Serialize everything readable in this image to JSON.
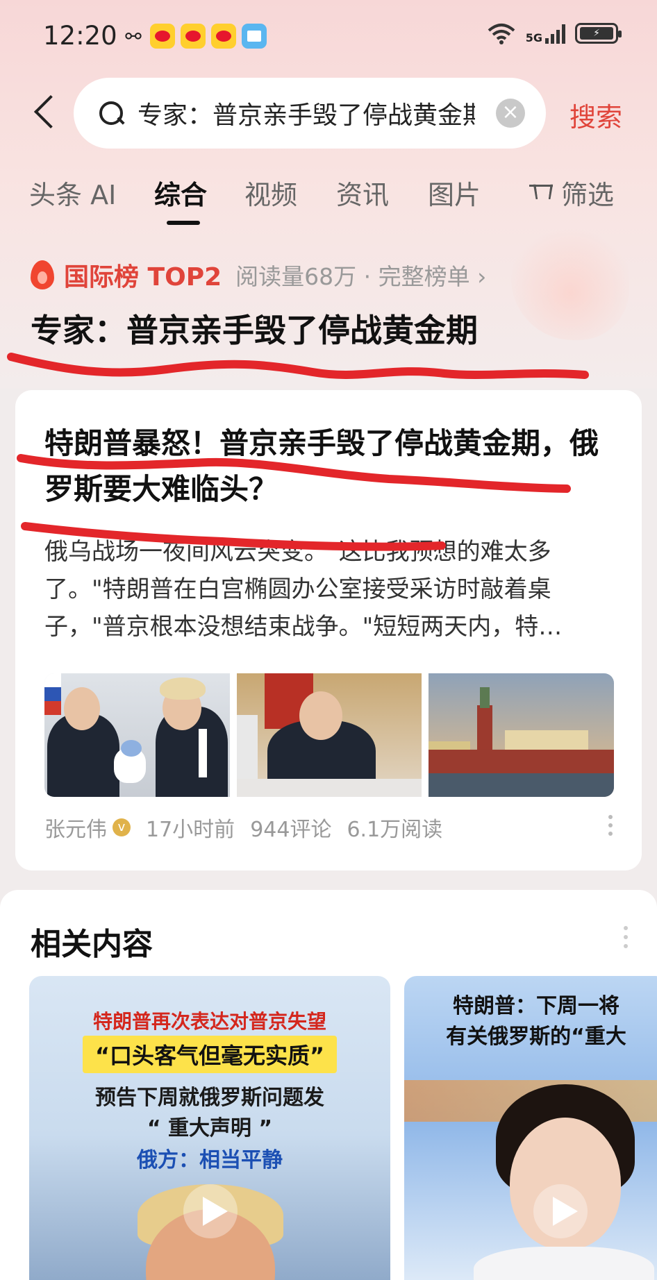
{
  "status_bar": {
    "time": "12:20",
    "network": "5G",
    "icons": [
      "link-icon",
      "weibo-icon",
      "weibo-icon",
      "weibo-icon",
      "book-icon",
      "wifi-icon",
      "signal-icon",
      "battery-icon"
    ]
  },
  "search": {
    "query": "专家：普京亲手毁了停战黄金期",
    "button_label": "搜索"
  },
  "tabs": [
    {
      "label": "头条 AI",
      "active": false
    },
    {
      "label": "综合",
      "active": true
    },
    {
      "label": "视频",
      "active": false
    },
    {
      "label": "资讯",
      "active": false
    },
    {
      "label": "图片",
      "active": false
    }
  ],
  "filter_label": "筛选",
  "ranking": {
    "label": "国际榜 TOP2",
    "meta": "阅读量68万 · 完整榜单 ›",
    "title": "专家：普京亲手毁了停战黄金期"
  },
  "article": {
    "title": "特朗普暴怒！普京亲手毁了停战黄金期，俄罗斯要大难临头？",
    "summary": "俄乌战场一夜间风云突变。\"这比我预想的难太多了。\"特朗普在白宫椭圆办公室接受采访时敲着桌子，\"普京根本没想结束战争。\"短短两天内，特…",
    "author": "张元伟",
    "time": "17小时前",
    "comments": "944评论",
    "reads": "6.1万阅读",
    "verified_mark": "v"
  },
  "related": {
    "title": "相关内容",
    "videos": [
      {
        "line1": "特朗普再次表达对普京失望",
        "line2": "“口头客气但毫无实质”",
        "line3": "预告下周就俄罗斯问题发",
        "line4": "“ 重大声明 ”",
        "line5": "俄方：相当平静"
      },
      {
        "line1": "特朗普：下周一将",
        "line2": "有关俄罗斯的“重大"
      }
    ]
  },
  "colors": {
    "accent": "#e0443a",
    "annotation": "#e3262a"
  }
}
